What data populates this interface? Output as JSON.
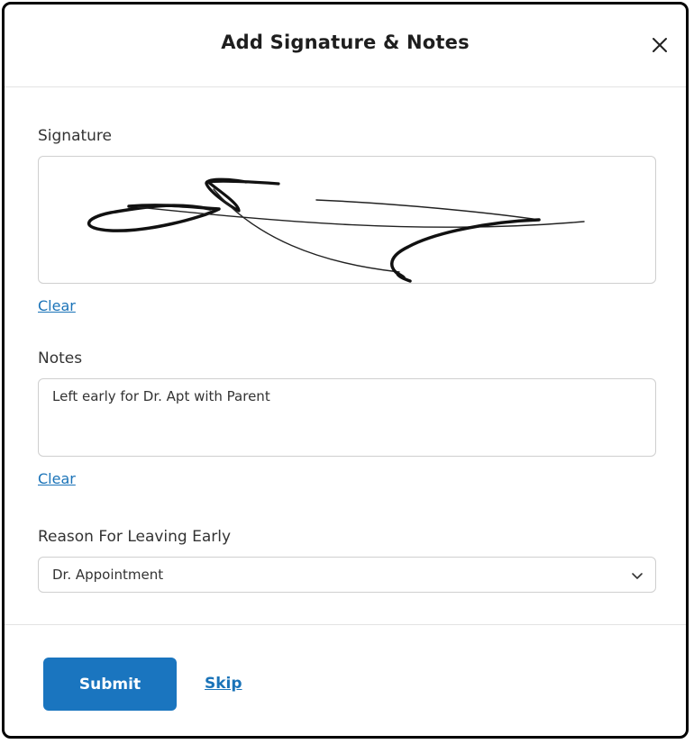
{
  "dialog": {
    "title": "Add Signature & Notes",
    "close_icon": "close-icon"
  },
  "signature": {
    "label": "Signature",
    "clear_label": "Clear"
  },
  "notes": {
    "label": "Notes",
    "value": "Left early for Dr. Apt with Parent",
    "clear_label": "Clear"
  },
  "reason": {
    "label": "Reason For Leaving Early",
    "selected": "Dr. Appointment",
    "chevron_icon": "chevron-down-icon"
  },
  "footer": {
    "submit_label": "Submit",
    "skip_label": "Skip"
  },
  "colors": {
    "accent": "#1a75bf",
    "link": "#1a73b8",
    "border": "#cfcfcf"
  }
}
